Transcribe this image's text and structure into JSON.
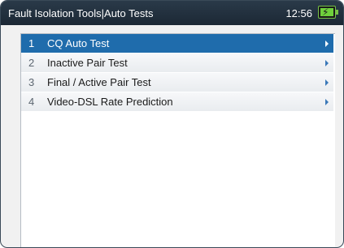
{
  "window": {
    "title": "Fault Isolation Tools|Auto Tests",
    "clock": "12:56",
    "battery_icon": "battery-charging-icon"
  },
  "menu": {
    "selected_index": 0,
    "items": [
      {
        "number": "1",
        "label": "CQ Auto Test",
        "icon": "chevron-right-icon"
      },
      {
        "number": "2",
        "label": "Inactive Pair Test",
        "icon": "chevron-right-icon"
      },
      {
        "number": "3",
        "label": "Final / Active Pair Test",
        "icon": "chevron-right-icon"
      },
      {
        "number": "4",
        "label": "Video-DSL Rate Prediction",
        "icon": "chevron-right-icon"
      }
    ]
  },
  "colors": {
    "titlebar": "#1c2835",
    "selection": "#1f6cac",
    "battery": "#6fd13c",
    "arrow": "#3a78b8"
  }
}
